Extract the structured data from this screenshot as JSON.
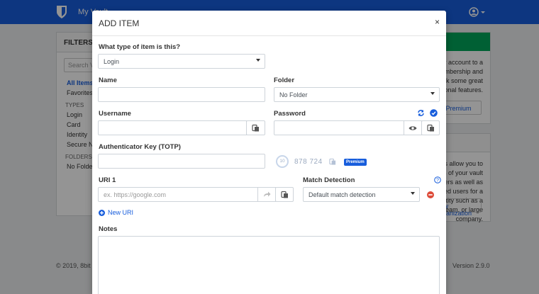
{
  "app": {
    "title": "My Vault",
    "footer_left": "© 2019, 8bit Solutions LLC",
    "footer_right": "Version 2.9.0"
  },
  "filters": {
    "header": "FILTERS",
    "search_placeholder": "Search Vault",
    "all_items": "All Items",
    "favorites": "Favorites",
    "types_header": "TYPES",
    "types": [
      "Login",
      "Card",
      "Identity",
      "Secure Note"
    ],
    "folders_header": "FOLDERS",
    "no_folder": "No Folder"
  },
  "premium_panel": {
    "text": "Upgrade your account to a premium membership and unlock some great additional features.",
    "button": "Go Premium"
  },
  "org_panel": {
    "text": "Organizations allow you to share parts of your vault with others as well as manage related users for a specific entity such as a family, small team, or large company.",
    "button": "New Organization"
  },
  "modal": {
    "title": "ADD ITEM",
    "close_glyph": "×",
    "type_label": "What type of item is this?",
    "type_value": "Login",
    "name_label": "Name",
    "name_value": "",
    "folder_label": "Folder",
    "folder_value": "No Folder",
    "username_label": "Username",
    "username_value": "",
    "password_label": "Password",
    "password_value": "",
    "totp_label": "Authenticator Key (TOTP)",
    "totp_value": "",
    "totp_seconds": "10",
    "totp_code": "878  724",
    "premium_badge": "Premium",
    "uri_label": "URI 1",
    "uri_placeholder": "ex. https://google.com",
    "match_label": "Match Detection",
    "match_value": "Default match detection",
    "new_uri": "New URI",
    "notes_label": "Notes",
    "notes_value": ""
  },
  "colors": {
    "brand": "#175ddc",
    "remove": "#dd4b39",
    "premium_green": "#00a65a"
  }
}
